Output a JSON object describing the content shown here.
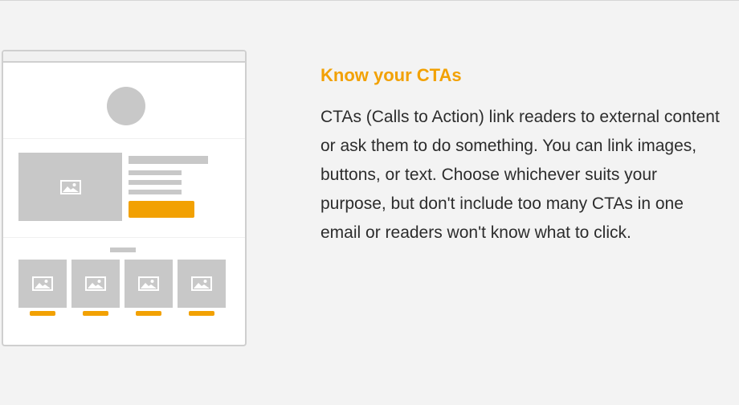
{
  "section": {
    "heading": "Know your CTAs",
    "body": "CTAs (Calls to Action) link readers to external content or ask them to do something. You can link images, buttons, or text. Choose whichever suits your purpose, but don't include too many CTAs in one email or readers won't know what to click."
  },
  "illustration": {
    "icons": [
      "image-icon"
    ],
    "colors": {
      "accent": "#f2a103",
      "placeholder": "#c8c8c8",
      "frame": "#cfcfcf",
      "background": "#f3f3f3"
    }
  }
}
